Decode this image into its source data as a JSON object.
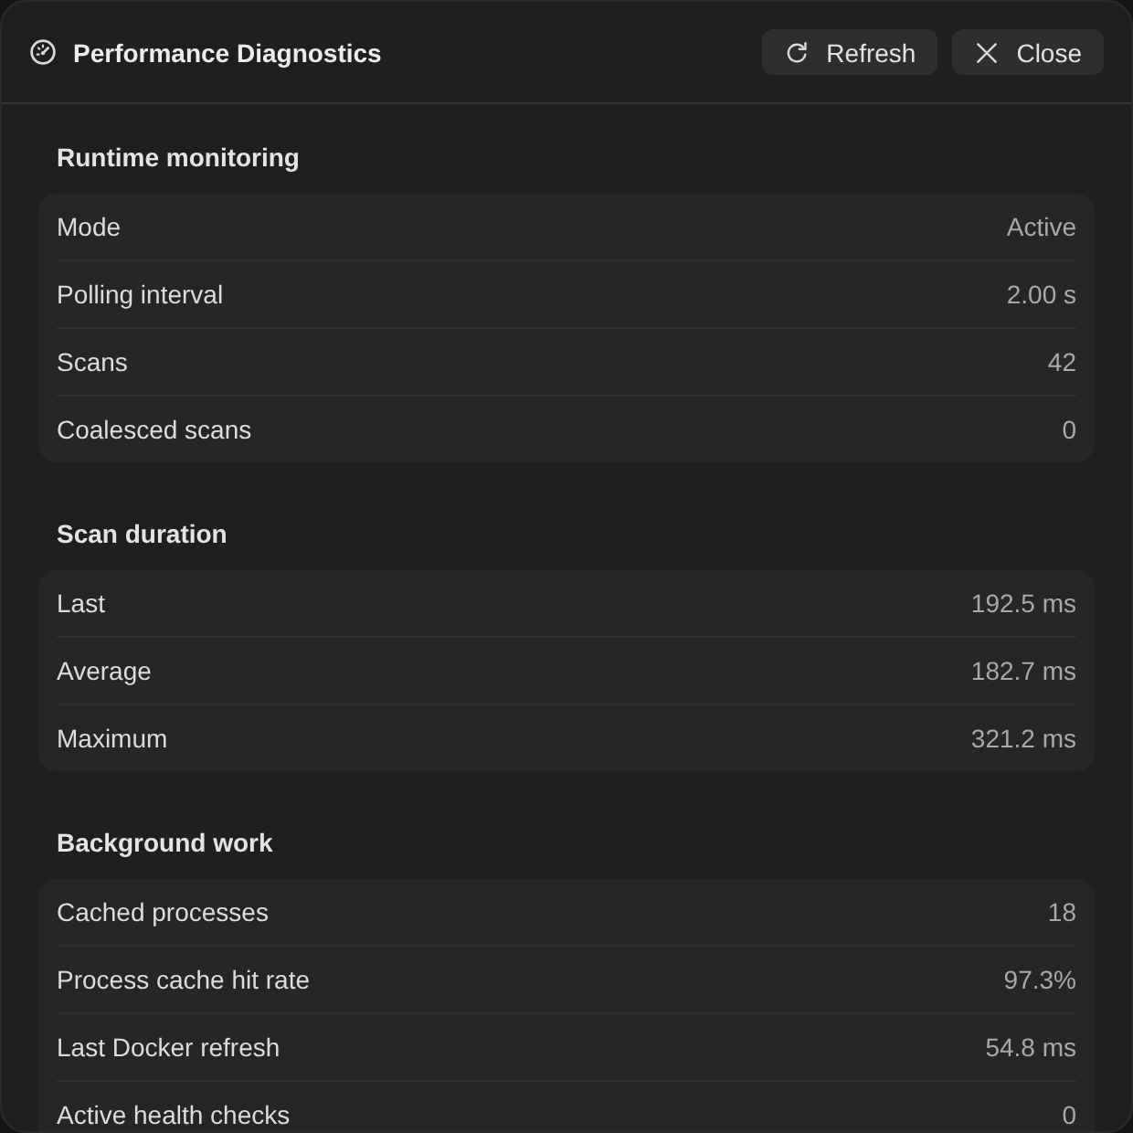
{
  "window": {
    "title": "Performance Diagnostics"
  },
  "buttons": [
    {
      "kind": "refresh",
      "label": "Refresh"
    },
    {
      "kind": "close",
      "label": "Close"
    }
  ],
  "sections": [
    {
      "title": "Runtime monitoring",
      "rows": [
        {
          "label": "Mode",
          "value": "Active"
        },
        {
          "label": "Polling interval",
          "value": "2.00 s"
        },
        {
          "label": "Scans",
          "value": "42"
        },
        {
          "label": "Coalesced scans",
          "value": "0"
        }
      ]
    },
    {
      "title": "Scan duration",
      "rows": [
        {
          "label": "Last",
          "value": "192.5 ms"
        },
        {
          "label": "Average",
          "value": "182.7 ms"
        },
        {
          "label": "Maximum",
          "value": "321.2 ms"
        }
      ]
    },
    {
      "title": "Background work",
      "rows": [
        {
          "label": "Cached processes",
          "value": "18"
        },
        {
          "label": "Process cache hit rate",
          "value": "97.3%"
        },
        {
          "label": "Last Docker refresh",
          "value": "54.8 ms"
        },
        {
          "label": "Active health checks",
          "value": "0"
        }
      ]
    }
  ]
}
